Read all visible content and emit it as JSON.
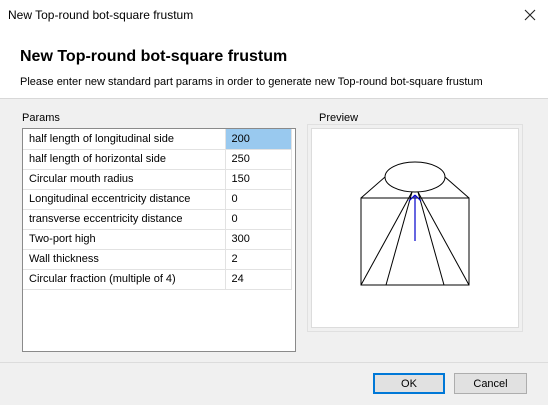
{
  "window": {
    "title": "New Top-round bot-square frustum",
    "close_glyph": "✕"
  },
  "header": {
    "title": "New Top-round bot-square frustum",
    "description": "Please enter new standard part params in order to generate new Top-round bot-square frustum"
  },
  "params": {
    "group_label": "Params",
    "rows": [
      {
        "name": "half length of longitudinal side",
        "value": "200"
      },
      {
        "name": "half length of horizontal side",
        "value": "250"
      },
      {
        "name": "Circular mouth radius",
        "value": "150"
      },
      {
        "name": "Longitudinal eccentricity distance",
        "value": "0"
      },
      {
        "name": "transverse eccentricity distance",
        "value": "0"
      },
      {
        "name": "Two-port high",
        "value": "300"
      },
      {
        "name": "Wall thickness",
        "value": "2"
      },
      {
        "name": "Circular fraction (multiple of 4)",
        "value": "24"
      }
    ],
    "selected_row": 0
  },
  "preview": {
    "group_label": "Preview",
    "line_color": "#000000",
    "axis_color": "#0000cc"
  },
  "buttons": {
    "ok_label": "OK",
    "cancel_label": "Cancel"
  }
}
